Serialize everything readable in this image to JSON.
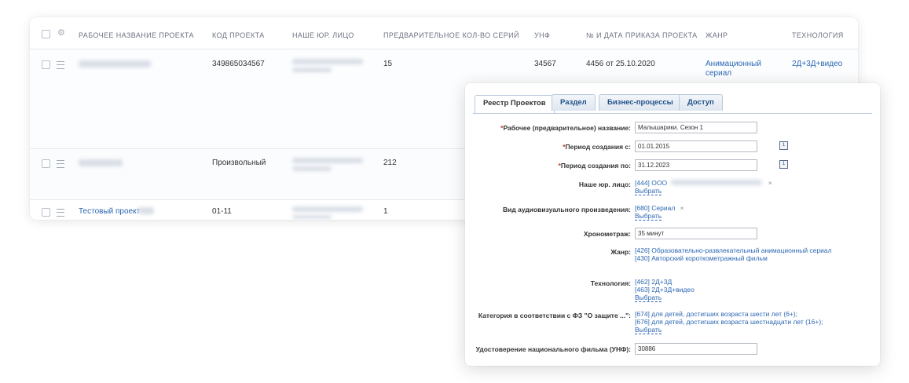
{
  "table": {
    "columns": [
      "РАБОЧЕЕ НАЗВАНИЕ ПРОЕКТА",
      "КОД ПРОЕКТА",
      "НАШЕ ЮР. ЛИЦО",
      "ПРЕДВАРИТЕЛЬНОЕ КОЛ-ВО СЕРИЙ",
      "УНФ",
      "№ И ДАТА ПРИКАЗА ПРОЕКТА",
      "ЖАНР",
      "ТЕХНОЛОГИЯ"
    ],
    "rows": [
      {
        "name": "",
        "code": "349865034567",
        "series": "15",
        "unf": "34567",
        "order": "4456 от 25.10.2020",
        "genre": "Анимационный сериал",
        "tech": "2Д+3Д+видео"
      },
      {
        "name": "",
        "code": "Произвольный",
        "series": "212"
      },
      {
        "name": "Тестовый проект",
        "code": "01-11",
        "series": "1"
      }
    ]
  },
  "modal": {
    "tabs": [
      "Реестр Проектов",
      "Раздел",
      "Бизнес-процессы",
      "Доступ"
    ],
    "fields": {
      "name_label": "Рабочее (предварительное) название:",
      "name_value": "Малышарики. Сезон 1",
      "start_label": "Период создания с:",
      "start_value": "01.01.2015",
      "end_label": "Период создания по:",
      "end_value": "31.12.2023",
      "entity_label": "Наше юр. лицо:",
      "entity_value": "[444] ООО",
      "entity_select": "Выбрать",
      "work_type_label": "Вид аудиовизуального произведения:",
      "work_type_value": "[680] Сериал",
      "work_type_select": "Выбрать",
      "duration_label": "Хронометраж:",
      "duration_value": "35 минут",
      "genre_label": "Жанр:",
      "genre_1": "[426] Образовательно-развлекательный анимационный сериал",
      "genre_2": "[430] Авторский короткометражный фильм",
      "tech_label": "Технология:",
      "tech_1": "[462] 2Д+3Д",
      "tech_2": "[463] 2Д+3Д+видео",
      "tech_select": "Выбрать",
      "category_label": "Категория в соответствии с ФЗ \"О защите ...\":",
      "category_1": "[674] для детей, достигших возраста шести лет (6+);",
      "category_2": "[676] для детей, достигших возраста шестнадцати лет (16+);",
      "category_select": "Выбрать",
      "unf_label": "Удостоверение национального фильма (УНФ):",
      "unf_value": "30886"
    },
    "remove_glyph": "×",
    "required_mark": "*"
  },
  "icons": {
    "gear": "gear-icon",
    "menu": "menu-icon",
    "calendar": "calendar-icon"
  },
  "colors": {
    "link": "#2b67b3",
    "tab_text": "#1f4f86",
    "required": "#c0392b"
  }
}
